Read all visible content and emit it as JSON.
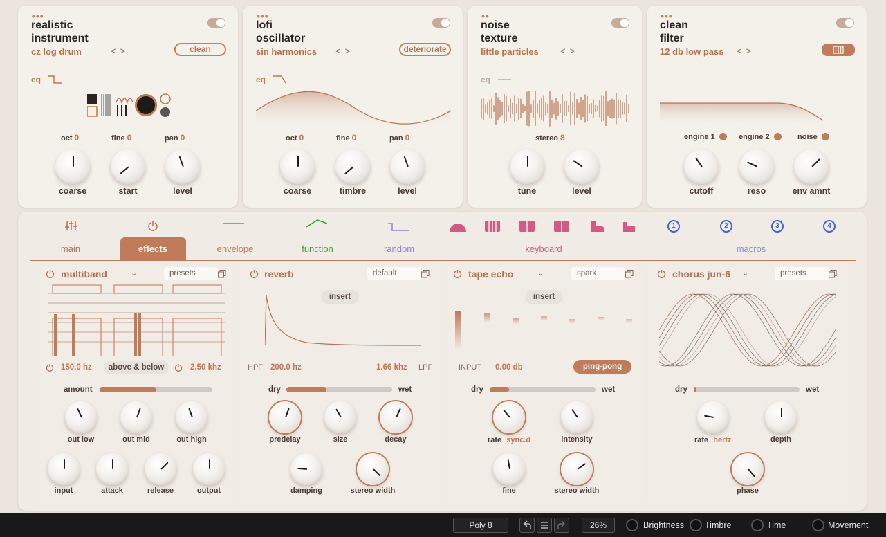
{
  "engines": [
    {
      "title1": "realistic",
      "title2": "instrument",
      "sub": "cz log drum",
      "pill": "clean",
      "eq": "eq",
      "params": [
        {
          "label": "oct",
          "value": "0"
        },
        {
          "label": "fine",
          "value": "0"
        },
        {
          "label": "pan",
          "value": "0"
        }
      ],
      "knobs": [
        "coarse",
        "start",
        "level"
      ]
    },
    {
      "title1": "lofi",
      "title2": "oscillator",
      "sub": "sin harmonics",
      "pill": "deteriorate",
      "eq": "eq",
      "params": [
        {
          "label": "oct",
          "value": "0"
        },
        {
          "label": "fine",
          "value": "0"
        },
        {
          "label": "pan",
          "value": "0"
        }
      ],
      "knobs": [
        "coarse",
        "timbre",
        "level"
      ]
    },
    {
      "title1": "noise",
      "title2": "texture",
      "sub": "little particles",
      "eq": "eq",
      "params": [
        {
          "label": "stereo",
          "value": "8"
        }
      ],
      "knobs": [
        "tune",
        "level"
      ]
    },
    {
      "title1": "clean",
      "title2": "filter",
      "sub": "12 db low pass",
      "params": [
        {
          "label": "engine 1"
        },
        {
          "label": "engine 2"
        },
        {
          "label": "noise"
        }
      ],
      "knobs": [
        "cutoff",
        "reso",
        "env amnt"
      ]
    }
  ],
  "tabs": {
    "main": "main",
    "effects": "effects",
    "envelope": "envelope",
    "function": "function",
    "random": "random",
    "keyboard": "keyboard",
    "macros": "macros"
  },
  "macro_numbers": [
    "1",
    "2",
    "3",
    "4"
  ],
  "fx": {
    "multiband": {
      "name": "multiband",
      "preset": "presets",
      "low": "150.0 hz",
      "mode": "above & below",
      "high": "2.50 khz",
      "amount": "amount",
      "amount_value": 0.5,
      "knobs1": [
        "out low",
        "out mid",
        "out high"
      ],
      "knobs2": [
        "input",
        "attack",
        "release",
        "output"
      ]
    },
    "reverb": {
      "name": "reverb",
      "preset": "default",
      "insert": "insert",
      "hpf": "HPF",
      "hpf_value": "200.0 hz",
      "lpf_value": "1.66 khz",
      "lpf": "LPF",
      "dry": "dry",
      "wet": "wet",
      "mix": 0.38,
      "knobs1": [
        "predelay",
        "size",
        "decay"
      ],
      "knobs2": [
        "damping",
        "stereo width"
      ]
    },
    "tape": {
      "name": "tape echo",
      "preset": "spark",
      "insert": "insert",
      "input": "INPUT",
      "input_value": "0.00 db",
      "mode": "ping-pong",
      "dry": "dry",
      "wet": "wet",
      "mix": 0.18,
      "rate": "rate",
      "rate_mode": "sync.d",
      "knobs": [
        "intensity",
        "fine",
        "stereo width"
      ]
    },
    "chorus": {
      "name": "chorus jun-6",
      "preset": "presets",
      "dry": "dry",
      "wet": "wet",
      "mix": 0.02,
      "rate": "rate",
      "rate_mode": "hertz",
      "knobs": [
        "depth",
        "phase"
      ]
    }
  },
  "bottom": {
    "poly": "Poly 8",
    "zoom": "26%",
    "macros": [
      "Brightness",
      "Timbre",
      "Time",
      "Movement"
    ]
  },
  "colors": {
    "accent": "#c27554",
    "function": "#2fa52f",
    "random": "#9a7be0",
    "keyboard": "#d25a84",
    "macros": "#3f63d8"
  }
}
